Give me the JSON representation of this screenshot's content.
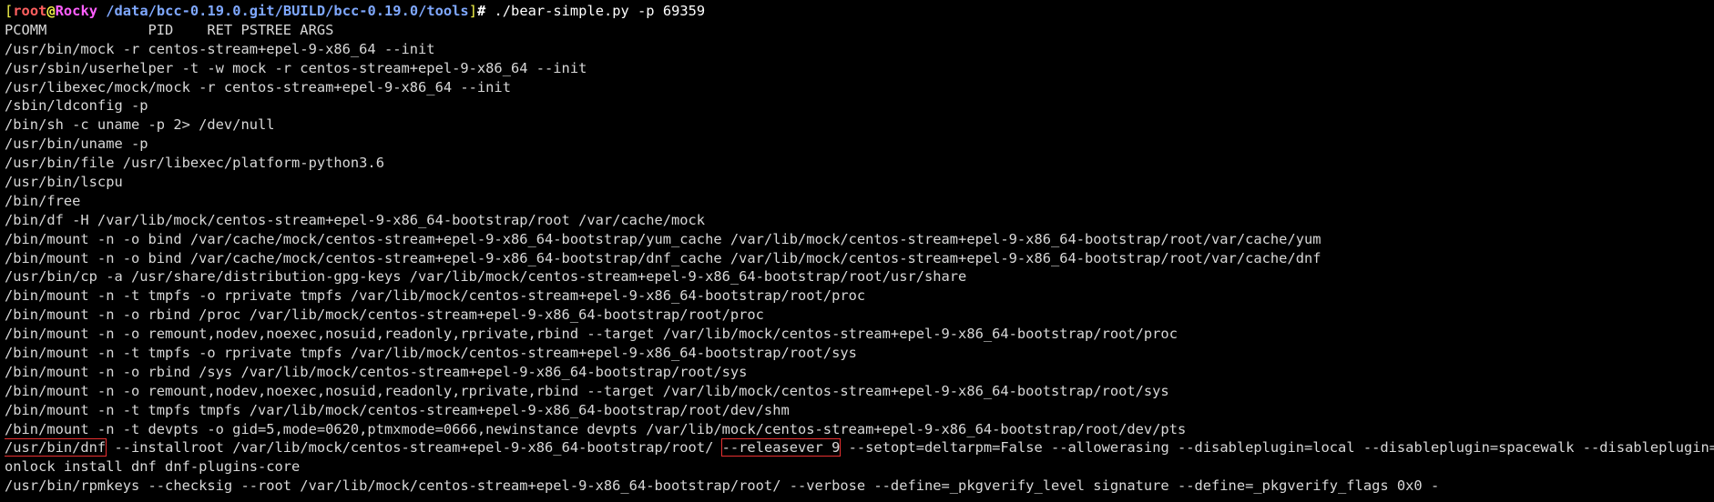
{
  "prompt": {
    "open_bracket": "[",
    "user": "root",
    "at": "@",
    "host": "Rocky",
    "path": " /data/bcc-0.19.0.git/BUILD/bcc-0.19.0/tools",
    "close_bracket": "]",
    "hash": "# ",
    "command": "./bear-simple.py -p 69359"
  },
  "header": "PCOMM            PID    RET PSTREE ARGS",
  "lines": [
    "/usr/bin/mock -r centos-stream+epel-9-x86_64 --init",
    "/usr/sbin/userhelper -t -w mock -r centos-stream+epel-9-x86_64 --init",
    "/usr/libexec/mock/mock -r centos-stream+epel-9-x86_64 --init",
    "/sbin/ldconfig -p",
    "/bin/sh -c uname -p 2> /dev/null",
    "/usr/bin/uname -p",
    "/usr/bin/file /usr/libexec/platform-python3.6",
    "/usr/bin/lscpu",
    "/bin/free",
    "/bin/df -H /var/lib/mock/centos-stream+epel-9-x86_64-bootstrap/root /var/cache/mock",
    "/bin/mount -n -o bind /var/cache/mock/centos-stream+epel-9-x86_64-bootstrap/yum_cache /var/lib/mock/centos-stream+epel-9-x86_64-bootstrap/root/var/cache/yum",
    "/bin/mount -n -o bind /var/cache/mock/centos-stream+epel-9-x86_64-bootstrap/dnf_cache /var/lib/mock/centos-stream+epel-9-x86_64-bootstrap/root/var/cache/dnf",
    "/usr/bin/cp -a /usr/share/distribution-gpg-keys /var/lib/mock/centos-stream+epel-9-x86_64-bootstrap/root/usr/share",
    "/bin/mount -n -t tmpfs -o rprivate tmpfs /var/lib/mock/centos-stream+epel-9-x86_64-bootstrap/root/proc",
    "/bin/mount -n -o rbind /proc /var/lib/mock/centos-stream+epel-9-x86_64-bootstrap/root/proc",
    "/bin/mount -n -o remount,nodev,noexec,nosuid,readonly,rprivate,rbind --target /var/lib/mock/centos-stream+epel-9-x86_64-bootstrap/root/proc",
    "/bin/mount -n -t tmpfs -o rprivate tmpfs /var/lib/mock/centos-stream+epel-9-x86_64-bootstrap/root/sys",
    "/bin/mount -n -o rbind /sys /var/lib/mock/centos-stream+epel-9-x86_64-bootstrap/root/sys",
    "/bin/mount -n -o remount,nodev,noexec,nosuid,readonly,rprivate,rbind --target /var/lib/mock/centos-stream+epel-9-x86_64-bootstrap/root/sys",
    "/bin/mount -n -t tmpfs tmpfs /var/lib/mock/centos-stream+epel-9-x86_64-bootstrap/root/dev/shm",
    "/bin/mount -n -t devpts -o gid=5,mode=0620,ptmxmode=0666,newinstance devpts /var/lib/mock/centos-stream+epel-9-x86_64-bootstrap/root/dev/pts"
  ],
  "dnf_line": {
    "boxed_cmd": "/usr/bin/dnf",
    "middle": " --installroot /var/lib/mock/centos-stream+epel-9-x86_64-bootstrap/root/ ",
    "boxed_releasever": "--releasever 9",
    "rest": " --setopt=deltarpm=False --allowerasing --disableplugin=local --disableplugin=spacewalk --disableplugin=versi"
  },
  "dnf_continuation": "onlock install dnf dnf-plugins-core",
  "last_line": "/usr/bin/rpmkeys --checksig --root /var/lib/mock/centos-stream+epel-9-x86_64-bootstrap/root/ --verbose --define=_pkgverify_level signature --define=_pkgverify_flags 0x0 -",
  "colors": {
    "background": "#000000",
    "foreground": "#d8d8d8",
    "highlight_box": "#e83030"
  }
}
